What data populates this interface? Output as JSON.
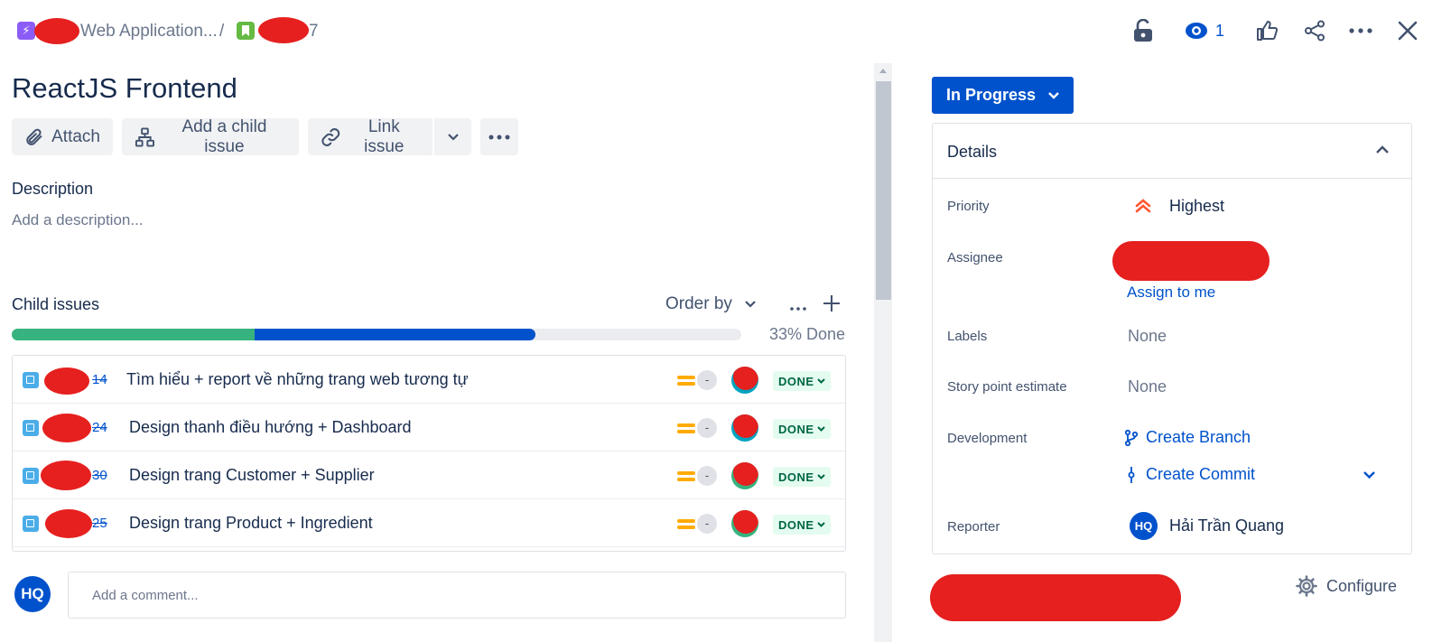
{
  "breadcrumb": {
    "project_label": "Web Application...",
    "separator": "/",
    "issue_key_suffix": "7"
  },
  "topbar": {
    "watchers_count": "1"
  },
  "issue": {
    "title": "ReactJS Frontend"
  },
  "actions": {
    "attach": "Attach",
    "add_child": "Add a child issue",
    "link_issue": "Link issue"
  },
  "description": {
    "label": "Description",
    "placeholder": "Add a description..."
  },
  "child_issues": {
    "label": "Child issues",
    "order_by": "Order by",
    "progress_text": "33% Done",
    "progress": {
      "done_fraction": 0.333,
      "in_progress_fraction": 0.385
    },
    "rows": [
      {
        "key_suffix": "14",
        "summary": "Tìm hiểu + report về những trang web tương tự",
        "estimate": "-",
        "status": "DONE"
      },
      {
        "key_suffix": "24",
        "summary": "Design thanh điều hướng + Dashboard",
        "estimate": "-",
        "status": "DONE"
      },
      {
        "key_suffix": "30",
        "summary": "Design trang Customer + Supplier",
        "estimate": "-",
        "status": "DONE"
      },
      {
        "key_suffix": "25",
        "summary": "Design trang Product + Ingredient",
        "estimate": "-",
        "status": "DONE"
      }
    ]
  },
  "comment": {
    "avatar_initials": "HQ",
    "placeholder": "Add a comment..."
  },
  "status_button": {
    "label": "In Progress"
  },
  "details": {
    "title": "Details",
    "priority_label": "Priority",
    "priority_value": "Highest",
    "assignee_label": "Assignee",
    "assign_to_me": "Assign to me",
    "labels_label": "Labels",
    "labels_value": "None",
    "story_points_label": "Story point estimate",
    "story_points_value": "None",
    "development_label": "Development",
    "create_branch": "Create Branch",
    "create_commit": "Create Commit",
    "reporter_label": "Reporter",
    "reporter_initials": "HQ",
    "reporter_name": "Hải Trần Quang"
  },
  "footer": {
    "configure": "Configure"
  },
  "colors": {
    "brand_blue": "#0052cc",
    "done_green": "#36b37e",
    "priority_highest": "#ff5630",
    "redaction": "#e5201f"
  },
  "icons": [
    "lightning-icon",
    "story-icon",
    "lock-icon",
    "eye-icon",
    "thumbs-up-icon",
    "share-icon",
    "more-icon",
    "close-icon",
    "paperclip-icon",
    "hierarchy-icon",
    "link-icon",
    "chevron-down-icon",
    "subtask-icon",
    "branch-icon",
    "commit-icon",
    "gear-icon"
  ]
}
